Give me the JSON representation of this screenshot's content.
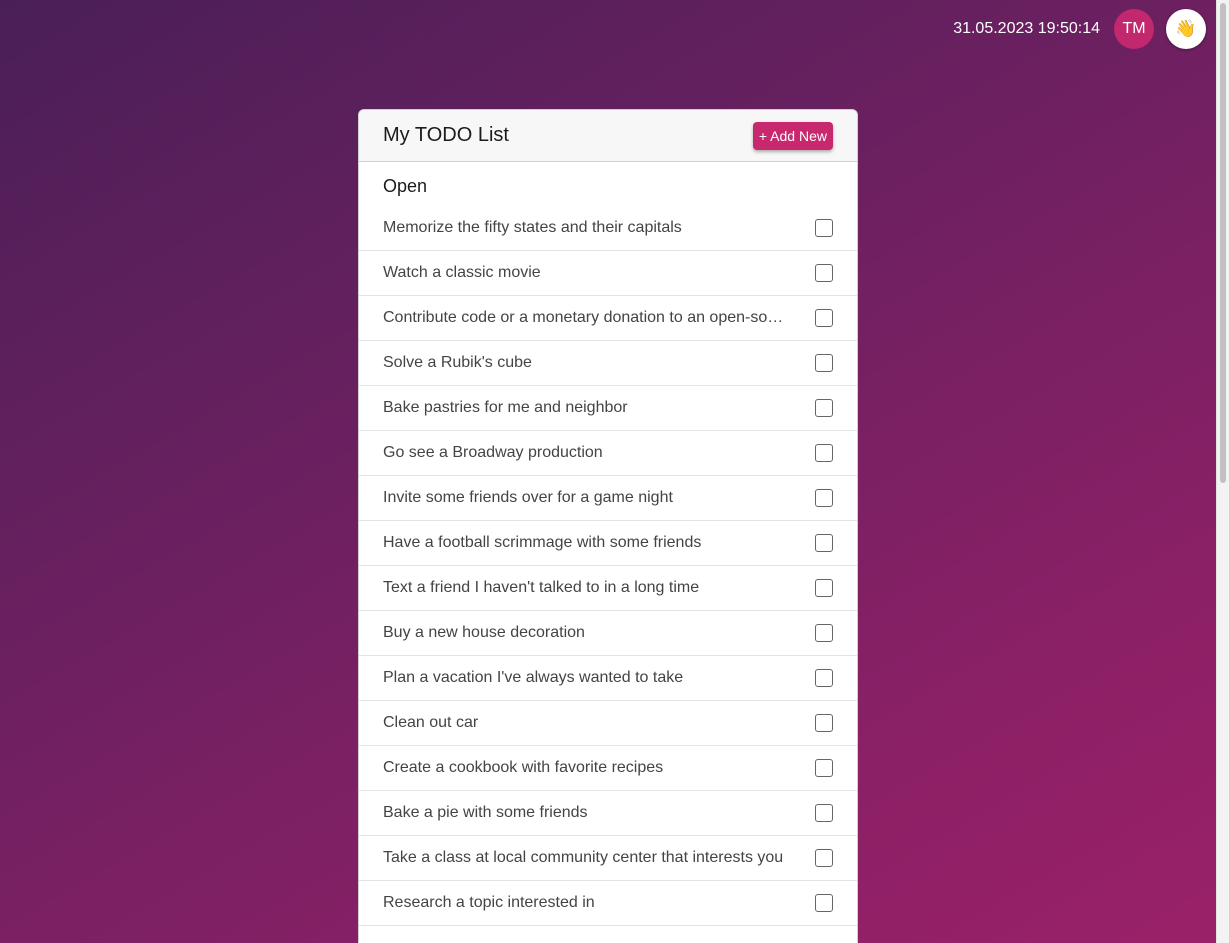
{
  "header": {
    "datetime": "31.05.2023 19:50:14",
    "avatar_initials": "TM",
    "wave_icon": "👋"
  },
  "colors": {
    "accent": "#c8286e",
    "background_start": "#4a1f58",
    "background_end": "#9a2168"
  },
  "todo": {
    "title": "My TODO List",
    "add_label": "+ Add New",
    "section_label": "Open",
    "items": [
      {
        "text": "Memorize the fifty states and their capitals",
        "done": false
      },
      {
        "text": "Watch a classic movie",
        "done": false
      },
      {
        "text": "Contribute code or a monetary donation to an open-so…",
        "done": false
      },
      {
        "text": "Solve a Rubik's cube",
        "done": false
      },
      {
        "text": "Bake pastries for me and neighbor",
        "done": false
      },
      {
        "text": "Go see a Broadway production",
        "done": false
      },
      {
        "text": "Invite some friends over for a game night",
        "done": false
      },
      {
        "text": "Have a football scrimmage with some friends",
        "done": false
      },
      {
        "text": "Text a friend I haven't talked to in a long time",
        "done": false
      },
      {
        "text": "Buy a new house decoration",
        "done": false
      },
      {
        "text": "Plan a vacation I've always wanted to take",
        "done": false
      },
      {
        "text": "Clean out car",
        "done": false
      },
      {
        "text": "Create a cookbook with favorite recipes",
        "done": false
      },
      {
        "text": "Bake a pie with some friends",
        "done": false
      },
      {
        "text": "Take a class at local community center that interests you",
        "done": false
      },
      {
        "text": "Research a topic interested in",
        "done": false
      }
    ]
  }
}
